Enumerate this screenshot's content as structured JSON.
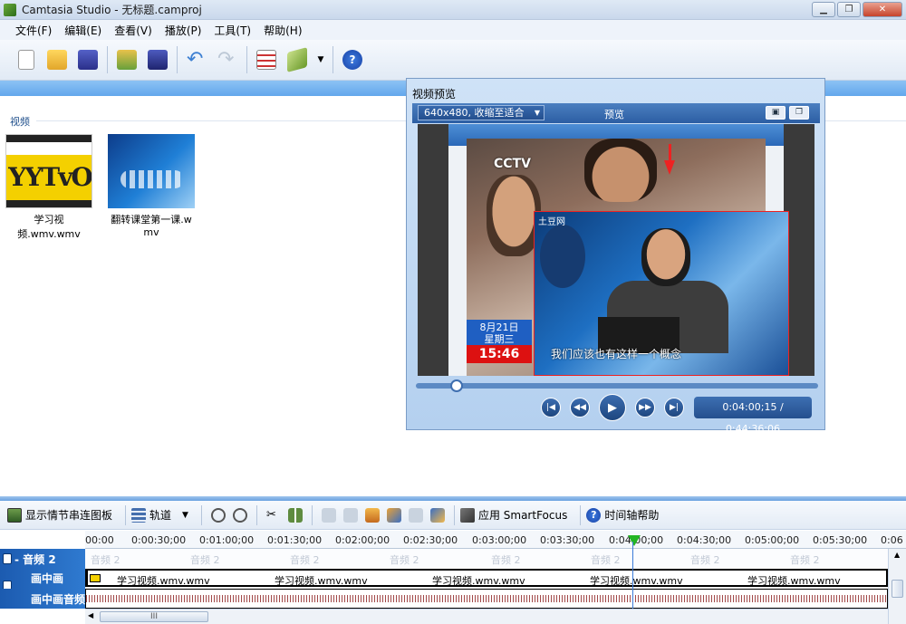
{
  "window": {
    "title": "Camtasia Studio - 无标题.camproj",
    "minimize": "▁",
    "restore": "❐",
    "close": "✕"
  },
  "menu": [
    "文件(F)",
    "编辑(E)",
    "查看(V)",
    "播放(P)",
    "工具(T)",
    "帮助(H)"
  ],
  "toolbar_icons": [
    "new-file-icon",
    "open-folder-icon",
    "save-icon",
    "import-media-icon",
    "save-as-icon",
    "undo-icon",
    "redo-icon",
    "task-list-icon",
    "produce-icon",
    "help-icon"
  ],
  "clipbin": {
    "section": "视频",
    "clips": [
      {
        "name": "学习视频.wmv.wmv",
        "thumb_text": "YYTvO"
      },
      {
        "name": "翻转课堂第一课.wmv"
      }
    ]
  },
  "preview": {
    "title": "视频预览",
    "size_select": "640x480, 收缩至适合",
    "mode_label": "预览",
    "video": {
      "channel": "CCTV",
      "date_line1": "8月21日",
      "date_line2": "星期三",
      "clock": "15:46",
      "pip_logo": "土豆网",
      "caption": "我们应该也有这样一个概念"
    },
    "timecode": "0:04:00;15 / 0:44:36;06",
    "progress_fraction": 0.09
  },
  "timeline": {
    "toolbar": {
      "storyboard": "显示情节串连图板",
      "tracks": "轨道",
      "smartfocus": "应用 SmartFocus",
      "help": "时间轴帮助"
    },
    "ruler_ticks": [
      "00:00",
      "0:00:30;00",
      "0:01:00;00",
      "0:01:30;00",
      "0:02:00;00",
      "0:02:30;00",
      "0:03:00;00",
      "0:03:30;00",
      "0:04:00;00",
      "0:04:30;00",
      "0:05:00;00",
      "0:05:30;00",
      "0:06"
    ],
    "playhead_time": "0:04:00;15",
    "tracks": [
      {
        "name": "- 音频 2",
        "ghost": "音频 2"
      },
      {
        "name": "画中画",
        "clip": "学习视频.wmv.wmv"
      },
      {
        "name": "画中画音频"
      }
    ],
    "hscroll_thumb": "III"
  },
  "colors": {
    "accent_blue": "#2f7ad0",
    "playhead_green": "#23b523",
    "highlight_red": "#e22222"
  }
}
